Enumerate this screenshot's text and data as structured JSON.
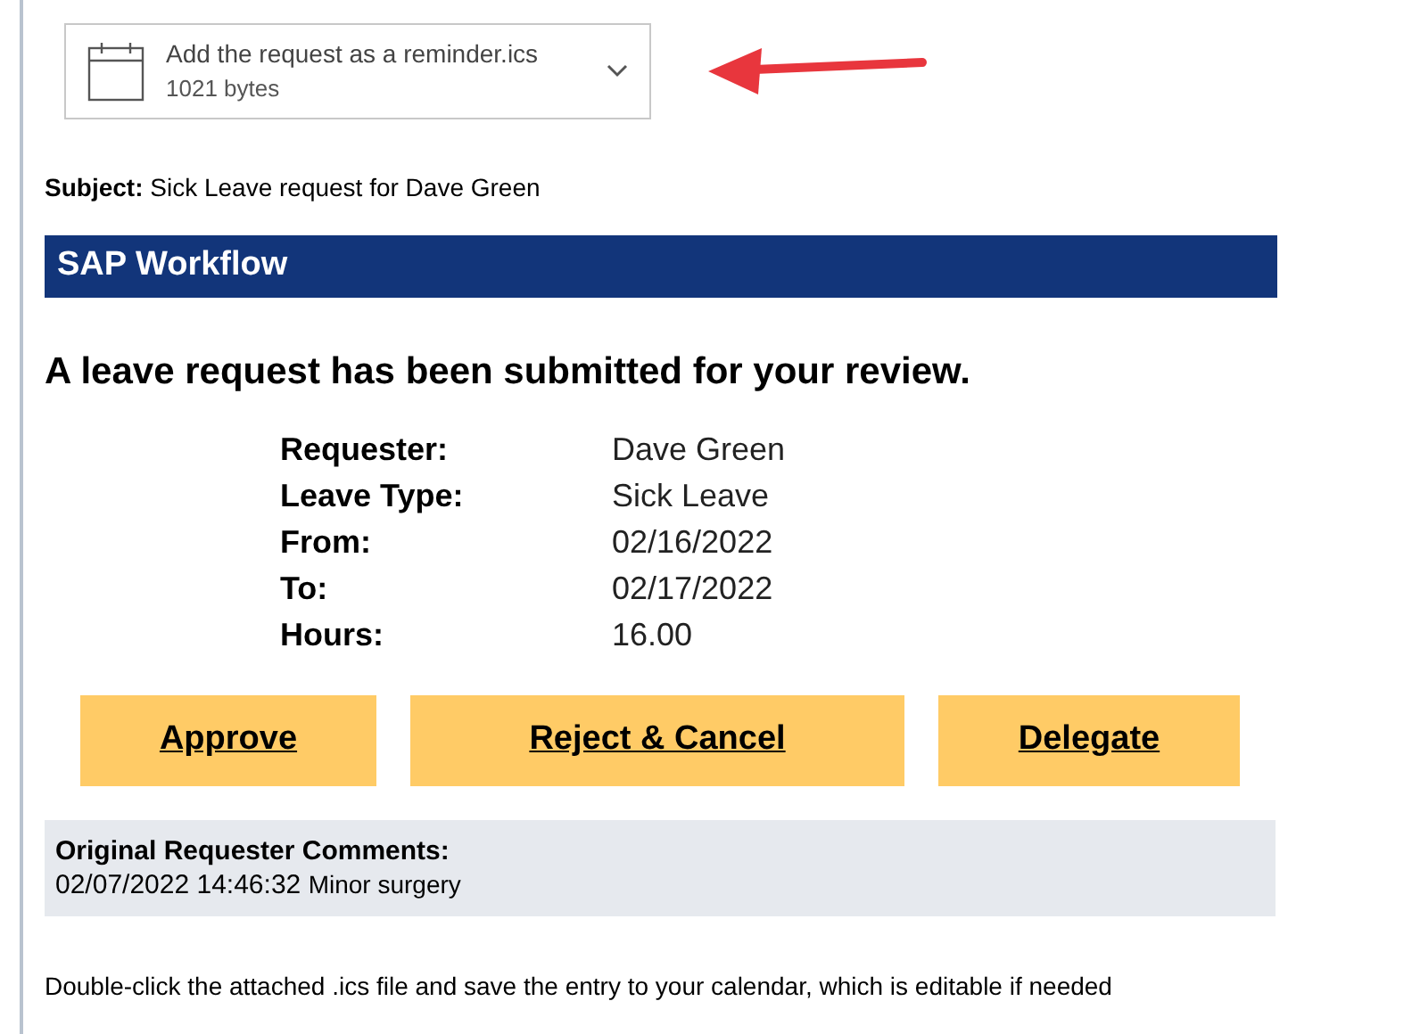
{
  "attachment": {
    "file_name": "Add the request as a reminder.ics",
    "size": "1021 bytes"
  },
  "subject": {
    "label": "Subject:",
    "text": "Sick Leave request for Dave Green"
  },
  "banner": {
    "title": "SAP Workflow"
  },
  "heading": "A leave request has been submitted for your review.",
  "details": [
    {
      "label": "Requester:",
      "value": "Dave Green"
    },
    {
      "label": "Leave Type:",
      "value": "Sick Leave"
    },
    {
      "label": "From:",
      "value": "02/16/2022"
    },
    {
      "label": "To:",
      "value": "02/17/2022"
    },
    {
      "label": "Hours:",
      "value": "16.00"
    }
  ],
  "actions": [
    "Approve",
    "Reject & Cancel",
    "Delegate"
  ],
  "comments": {
    "title": "Original Requester Comments:",
    "timestamp": "02/07/2022 14:46:32",
    "text": "Minor surgery"
  },
  "footer": "Double-click the attached .ics file and save the entry to your calendar, which is editable if needed"
}
